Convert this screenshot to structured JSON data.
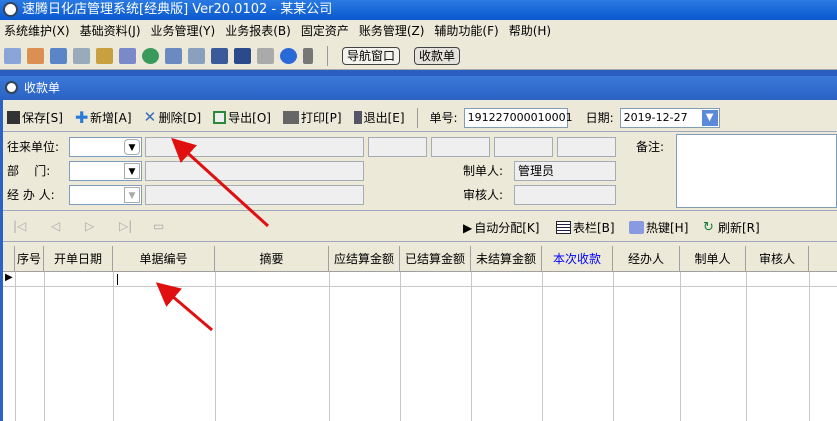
{
  "window": {
    "title": "速腾日化店管理系统[经典版] Ver20.0102  -  某某公司"
  },
  "menu": [
    "系统维护(X)",
    "基础资料(J)",
    "业务管理(Y)",
    "业务报表(B)",
    "固定资产",
    "账务管理(Z)",
    "辅助功能(F)",
    "帮助(H)"
  ],
  "quickbar": {
    "nav_window": "导航窗口",
    "receipt": "收款单"
  },
  "form_title": "收款单",
  "toolbar": {
    "save": "保存[S]",
    "add": "新增[A]",
    "delete": "删除[D]",
    "export": "导出[O]",
    "print": "打印[P]",
    "exit": "退出[E]",
    "doc_no_label": "单号:",
    "doc_no": "191227000010001",
    "date_label": "日期:",
    "date": "2019-12-27"
  },
  "form": {
    "partner_label": "往来单位:",
    "dept_label": "部    门:",
    "handler_label": "经 办 人:",
    "maker_label": "制单人:",
    "maker": "管理员",
    "auditor_label": "审核人:",
    "remark_label": "备注:"
  },
  "navbar": {
    "auto": "自动分配[K]",
    "columns": "表栏[B]",
    "hotkey": "热键[H]",
    "refresh": "刷新[R]"
  },
  "grid": {
    "columns": [
      "序号",
      "开单日期",
      "单据编号",
      "摘要",
      "应结算金额",
      "已结算金额",
      "未结算金额",
      "本次收款",
      "经办人",
      "制单人",
      "审核人"
    ],
    "highlight_color": "#0000ff"
  }
}
